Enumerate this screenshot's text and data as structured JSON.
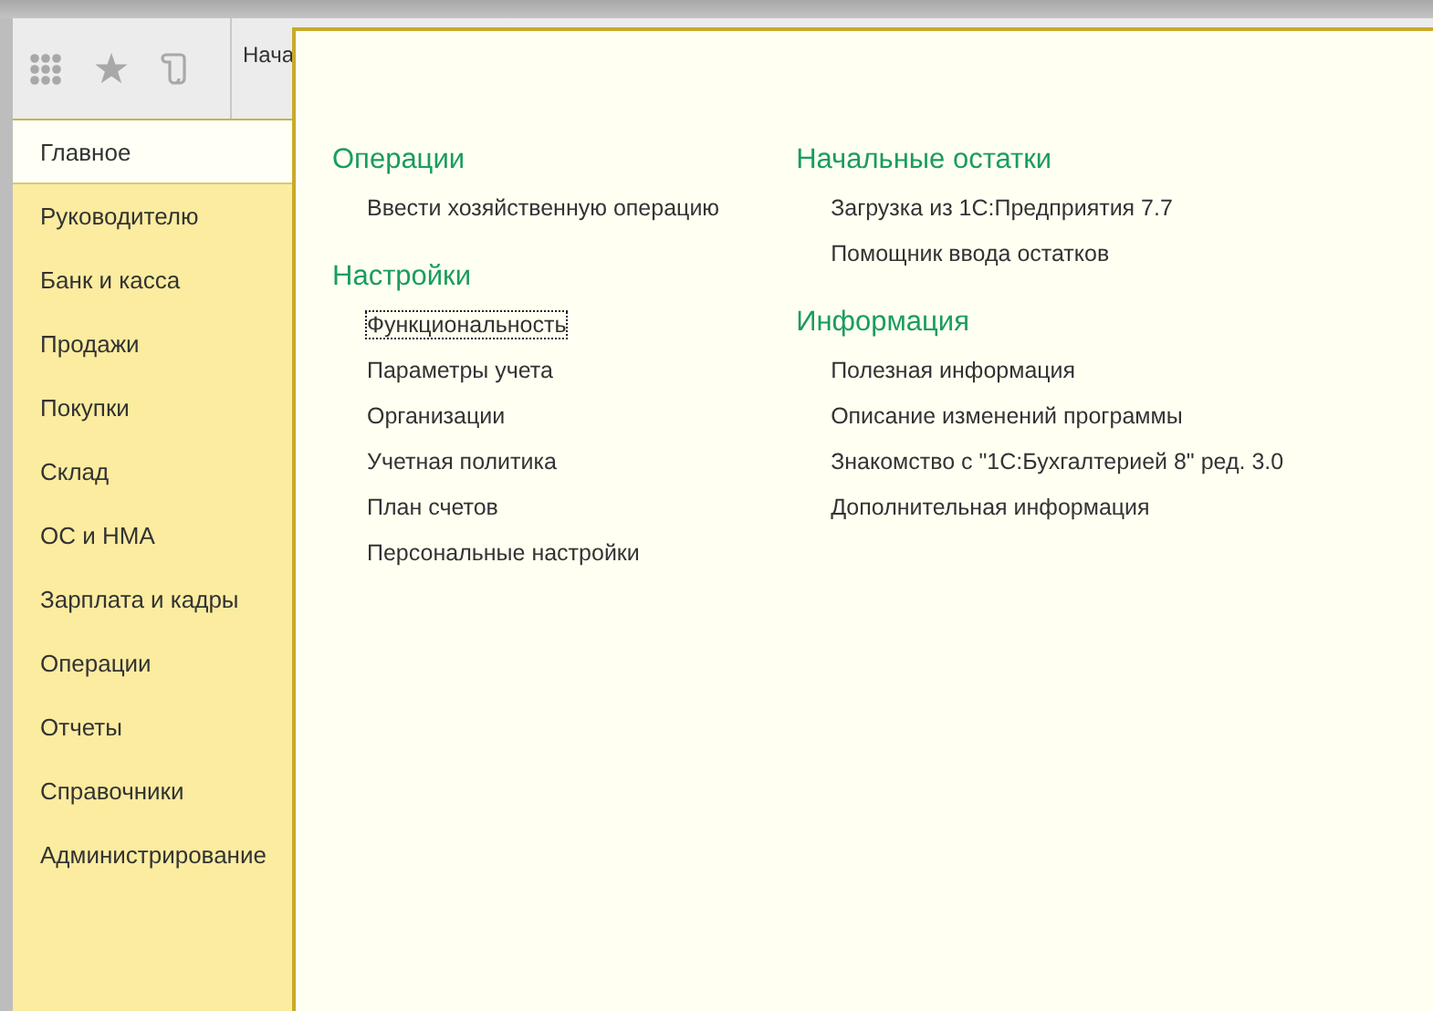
{
  "toolbar": {
    "tab": "Нача"
  },
  "sidebar": {
    "items": [
      {
        "label": "Главное",
        "selected": true
      },
      {
        "label": "Руководителю",
        "selected": false
      },
      {
        "label": "Банк и касса",
        "selected": false
      },
      {
        "label": "Продажи",
        "selected": false
      },
      {
        "label": "Покупки",
        "selected": false
      },
      {
        "label": "Склад",
        "selected": false
      },
      {
        "label": "ОС и НМА",
        "selected": false
      },
      {
        "label": "Зарплата и кадры",
        "selected": false
      },
      {
        "label": "Операции",
        "selected": false
      },
      {
        "label": "Отчеты",
        "selected": false
      },
      {
        "label": "Справочники",
        "selected": false
      },
      {
        "label": "Администрирование",
        "selected": false
      }
    ]
  },
  "panel": {
    "columns": [
      [
        {
          "title": "Операции",
          "links": [
            {
              "label": "Ввести хозяйственную операцию",
              "focused": false
            }
          ]
        },
        {
          "title": "Настройки",
          "links": [
            {
              "label": "Функциональность",
              "focused": true
            },
            {
              "label": "Параметры учета",
              "focused": false
            },
            {
              "label": "Организации",
              "focused": false
            },
            {
              "label": "Учетная политика",
              "focused": false
            },
            {
              "label": "План счетов",
              "focused": false
            },
            {
              "label": "Персональные настройки",
              "focused": false
            }
          ]
        }
      ],
      [
        {
          "title": "Начальные остатки",
          "links": [
            {
              "label": "Загрузка из 1С:Предприятия 7.7",
              "focused": false
            },
            {
              "label": "Помощник ввода остатков",
              "focused": false
            }
          ]
        },
        {
          "title": "Информация",
          "links": [
            {
              "label": "Полезная информация",
              "focused": false
            },
            {
              "label": "Описание изменений программы",
              "focused": false
            },
            {
              "label": "Знакомство с \"1С:Бухгалтерией 8\" ред. 3.0",
              "focused": false
            },
            {
              "label": "Дополнительная информация",
              "focused": false
            }
          ]
        }
      ]
    ]
  }
}
